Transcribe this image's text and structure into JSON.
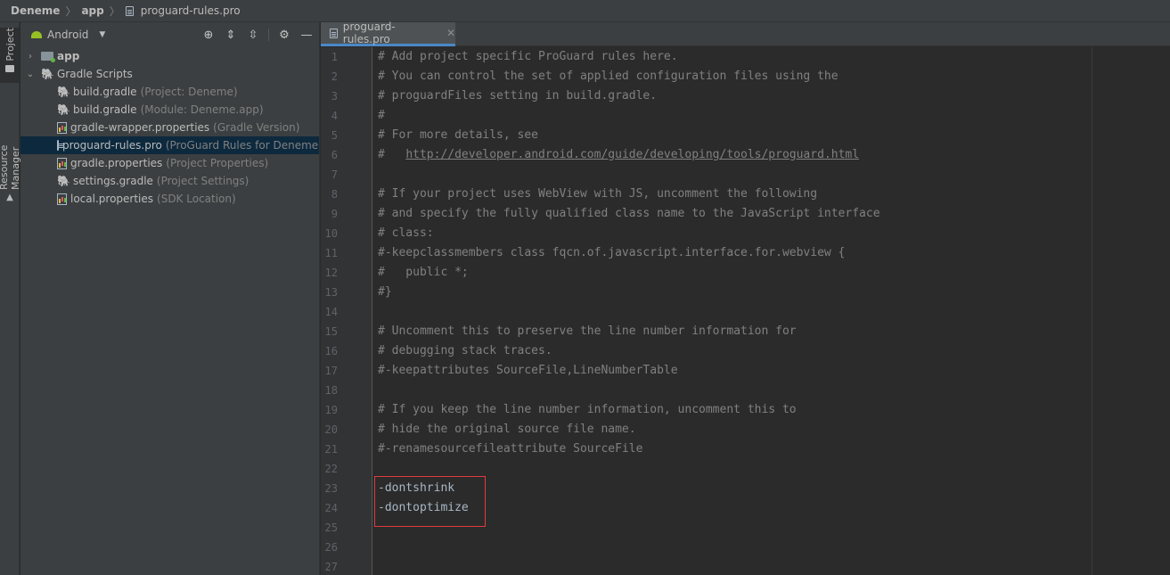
{
  "breadcrumb": {
    "project": "Deneme",
    "module": "app",
    "file": "proguard-rules.pro"
  },
  "side_strip": {
    "project_tab": "Project",
    "resource_tab": "Resource Manager"
  },
  "project_panel": {
    "view_mode": "Android",
    "tree": [
      {
        "name": "app",
        "hint": "",
        "icon": "folder-icon",
        "level": 0,
        "arrow": "›"
      },
      {
        "name": "Gradle Scripts",
        "hint": "",
        "icon": "gradle-icon",
        "level": 0,
        "arrow": "⌄"
      },
      {
        "name": "build.gradle",
        "hint": "(Project: Deneme)",
        "icon": "gradle-icon",
        "level": 1
      },
      {
        "name": "build.gradle",
        "hint": "(Module: Deneme.app)",
        "icon": "gradle-icon",
        "level": 1
      },
      {
        "name": "gradle-wrapper.properties",
        "hint": "(Gradle Version)",
        "icon": "properties-icon",
        "level": 1
      },
      {
        "name": "proguard-rules.pro",
        "hint": "(ProGuard Rules for Deneme.app)",
        "icon": "document-icon",
        "level": 1,
        "selected": true
      },
      {
        "name": "gradle.properties",
        "hint": "(Project Properties)",
        "icon": "properties-icon",
        "level": 1
      },
      {
        "name": "settings.gradle",
        "hint": "(Project Settings)",
        "icon": "gradle-icon",
        "level": 1
      },
      {
        "name": "local.properties",
        "hint": "(SDK Location)",
        "icon": "properties-icon",
        "level": 1
      }
    ]
  },
  "editor": {
    "tab_title": "proguard-rules.pro",
    "lines": [
      {
        "n": "1",
        "text": "# Add project specific ProGuard rules here."
      },
      {
        "n": "2",
        "text": "# You can control the set of applied configuration files using the"
      },
      {
        "n": "3",
        "text": "# proguardFiles setting in build.gradle."
      },
      {
        "n": "4",
        "text": "#"
      },
      {
        "n": "5",
        "text": "# For more details, see"
      },
      {
        "n": "6",
        "text": "#   ",
        "url": "http://developer.android.com/guide/developing/tools/proguard.html"
      },
      {
        "n": "7",
        "text": ""
      },
      {
        "n": "8",
        "text": "# If your project uses WebView with JS, uncomment the following"
      },
      {
        "n": "9",
        "text": "# and specify the fully qualified class name to the JavaScript interface"
      },
      {
        "n": "10",
        "text": "# class:"
      },
      {
        "n": "11",
        "text": "#-keepclassmembers class fqcn.of.javascript.interface.for.webview {"
      },
      {
        "n": "12",
        "text": "#   public *;"
      },
      {
        "n": "13",
        "text": "#}"
      },
      {
        "n": "14",
        "text": ""
      },
      {
        "n": "15",
        "text": "# Uncomment this to preserve the line number information for"
      },
      {
        "n": "16",
        "text": "# debugging stack traces."
      },
      {
        "n": "17",
        "text": "#-keepattributes SourceFile,LineNumberTable"
      },
      {
        "n": "18",
        "text": ""
      },
      {
        "n": "19",
        "text": "# If you keep the line number information, uncomment this to"
      },
      {
        "n": "20",
        "text": "# hide the original source file name."
      },
      {
        "n": "21",
        "text": "#-renamesourcefileattribute SourceFile"
      },
      {
        "n": "22",
        "text": ""
      },
      {
        "n": "23",
        "text": "-dontshrink",
        "plain": true
      },
      {
        "n": "24",
        "text": "-dontoptimize",
        "plain": true
      },
      {
        "n": "25",
        "text": ""
      },
      {
        "n": "26",
        "text": ""
      },
      {
        "n": "27",
        "text": ""
      }
    ]
  },
  "colors": {
    "highlight_box": "#e03b3b",
    "selection": "#0d293e",
    "comment": "#808080",
    "code": "#a9b7c6"
  }
}
